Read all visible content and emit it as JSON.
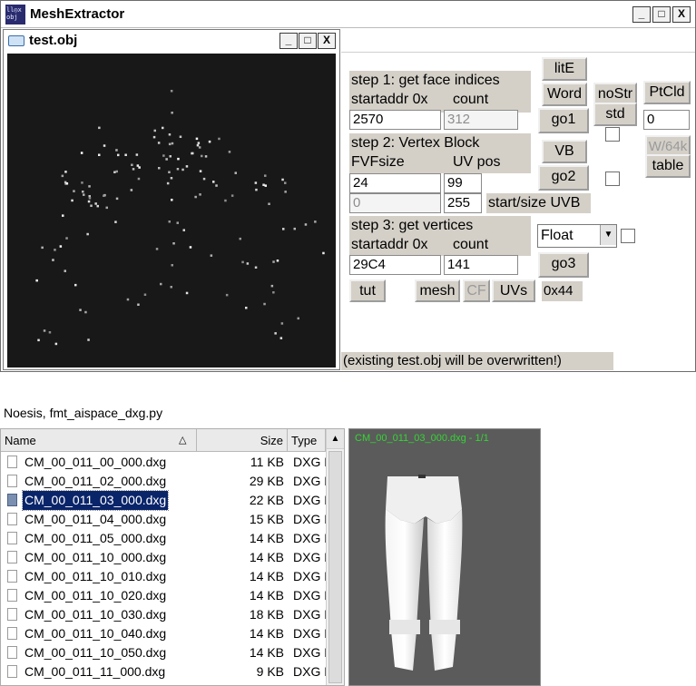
{
  "main_window": {
    "title": "MeshExtractor",
    "icon_text_top": "ll◎x",
    "icon_text_bottom": "obj",
    "controls": {
      "minimize": "_",
      "maximize": "□",
      "close": "X"
    }
  },
  "child_window": {
    "title": "test.obj",
    "controls": {
      "minimize": "_",
      "maximize": "□",
      "close": "X"
    }
  },
  "panel": {
    "step1": {
      "label": "step 1: get face indices",
      "sub_label_addr": "startaddr 0x",
      "sub_label_count": "count",
      "startaddr": "2570",
      "count": "312",
      "go_label": "go1"
    },
    "step2": {
      "label": "step 2: Vertex Block",
      "sub_label_fvf": "FVFsize",
      "sub_label_uv": "UV pos",
      "fvfsize": "24",
      "uvpos": "99",
      "uvb_start": "0",
      "uvb_size": "255",
      "uvb_label": "start/size UVB",
      "go_label": "go2"
    },
    "step3": {
      "label": "step 3: get vertices",
      "sub_label_addr": "startaddr 0x",
      "sub_label_count": "count",
      "startaddr": "29C4",
      "count": "141",
      "go_label": "go3",
      "format_selected": "Float"
    },
    "buttons": {
      "lite": "litE",
      "word": "Word",
      "nostr": "noStr",
      "ptcld": "PtCld",
      "std": "std",
      "vb": "VB",
      "w64k": "W/64k",
      "table": "table",
      "tut": "tut",
      "mesh": "mesh",
      "cf": "CF",
      "uvs": "UVs"
    },
    "ptcld_value": "0",
    "offset_label": "0x44",
    "status": "(existing test.obj will be overwritten!)"
  },
  "caption": "Noesis, fmt_aispace_dxg.py",
  "file_list": {
    "columns": {
      "name": "Name",
      "size": "Size",
      "type": "Type"
    },
    "sort_glyph": "△",
    "scroll_up_glyph": "▲",
    "rows": [
      {
        "name": "CM_00_011_00_000.dxg",
        "size": "11 KB",
        "type": "DXG F"
      },
      {
        "name": "CM_00_011_02_000.dxg",
        "size": "29 KB",
        "type": "DXG F"
      },
      {
        "name": "CM_00_011_03_000.dxg",
        "size": "22 KB",
        "type": "DXG F"
      },
      {
        "name": "CM_00_011_04_000.dxg",
        "size": "15 KB",
        "type": "DXG F"
      },
      {
        "name": "CM_00_011_05_000.dxg",
        "size": "14 KB",
        "type": "DXG F"
      },
      {
        "name": "CM_00_011_10_000.dxg",
        "size": "14 KB",
        "type": "DXG F"
      },
      {
        "name": "CM_00_011_10_010.dxg",
        "size": "14 KB",
        "type": "DXG F"
      },
      {
        "name": "CM_00_011_10_020.dxg",
        "size": "14 KB",
        "type": "DXG F"
      },
      {
        "name": "CM_00_011_10_030.dxg",
        "size": "18 KB",
        "type": "DXG F"
      },
      {
        "name": "CM_00_011_10_040.dxg",
        "size": "14 KB",
        "type": "DXG F"
      },
      {
        "name": "CM_00_011_10_050.dxg",
        "size": "14 KB",
        "type": "DXG F"
      },
      {
        "name": "CM_00_011_11_000.dxg",
        "size": "9 KB",
        "type": "DXG F"
      }
    ]
  },
  "preview": {
    "label": "CM_00_011_03_000.dxg - 1/1"
  },
  "colors": {
    "selection": "#0a246a",
    "preview_label": "#33d633",
    "viewport_bg": "#181818",
    "button_face": "#d4d0c8"
  }
}
